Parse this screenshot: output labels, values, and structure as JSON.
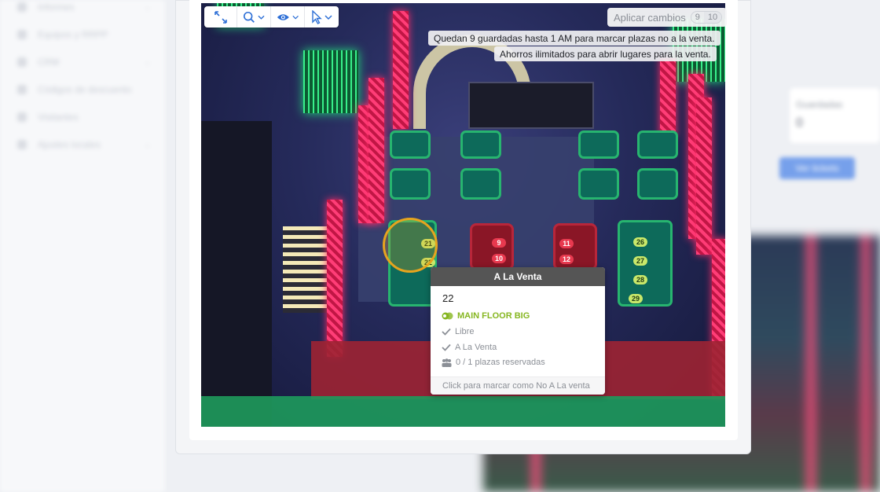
{
  "sidebar": {
    "items": [
      {
        "label": "Informes"
      },
      {
        "label": "Equipos y RRPP"
      },
      {
        "label": "CRM"
      },
      {
        "label": "Códigos de descuento"
      },
      {
        "label": "Visitantes"
      },
      {
        "label": "Ajustes locales"
      }
    ]
  },
  "background_panel": {
    "stat_label": "Guardadas",
    "stat_value": "0",
    "button_label": "Ver tickets"
  },
  "toolbar": {
    "tools": [
      "expand-icon",
      "zoom-icon",
      "eye-icon",
      "cursor-icon"
    ],
    "apply_label": "Aplicar cambios",
    "apply_count": "9",
    "apply_total": "10"
  },
  "notices": {
    "saved_left": "Quedan 9 guardadas hasta 1 AM para marcar plazas no a la venta.",
    "unlimited": "Ahorros ilimitados para abrir lugares para la venta."
  },
  "seats": {
    "green": [
      "21",
      "22",
      "26",
      "27",
      "28",
      "29"
    ],
    "red": [
      "9",
      "10",
      "11",
      "12"
    ]
  },
  "tooltip": {
    "header": "A La Venta",
    "seat_number": "22",
    "zone": "MAIN FLOOR BIG",
    "zone_color": "#86b620",
    "status": "Libre",
    "sale_state": "A La Venta",
    "reserved": "0 / 1 plazas reservadas",
    "footer": "Click para marcar como No A La venta"
  },
  "colors": {
    "selection_ring": "#e6a41e",
    "accent_blue": "#2d6fd6"
  }
}
